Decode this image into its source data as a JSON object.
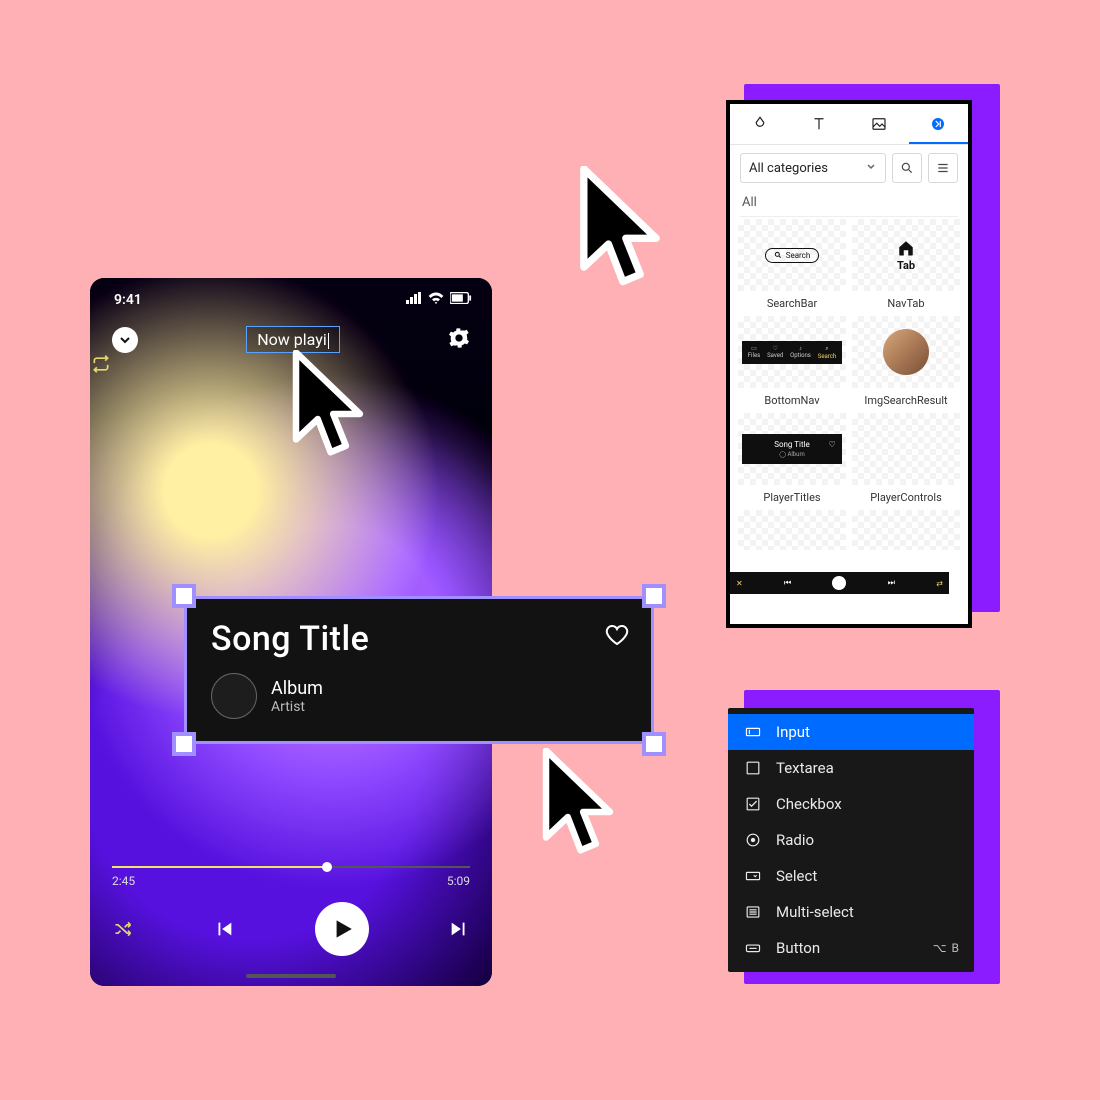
{
  "phone": {
    "status": {
      "time": "9:41"
    },
    "now_playing_input": "Now playi",
    "progress": {
      "elapsed": "2:45",
      "total": "5:09",
      "percent": 60
    },
    "bottom_nav_preview": [
      "Files",
      "Saved",
      "Options",
      "Search"
    ]
  },
  "card": {
    "song_title": "Song Title",
    "album": "Album",
    "artist": "Artist"
  },
  "components_panel": {
    "dropdown": "All categories",
    "heading": "All",
    "items": [
      {
        "label": "SearchBar",
        "kind": "searchbar",
        "text": "Search"
      },
      {
        "label": "NavTab",
        "kind": "navtab",
        "text": "Tab"
      },
      {
        "label": "BottomNav",
        "kind": "bottomnav"
      },
      {
        "label": "ImgSearchResult",
        "kind": "img"
      },
      {
        "label": "PlayerTitles",
        "kind": "titles",
        "title": "Song Title",
        "sub": "Album"
      },
      {
        "label": "PlayerControls",
        "kind": "controls"
      }
    ]
  },
  "menu": {
    "items": [
      {
        "label": "Input",
        "icon": "input",
        "selected": true
      },
      {
        "label": "Textarea",
        "icon": "textarea"
      },
      {
        "label": "Checkbox",
        "icon": "checkbox"
      },
      {
        "label": "Radio",
        "icon": "radio"
      },
      {
        "label": "Select",
        "icon": "select"
      },
      {
        "label": "Multi-select",
        "icon": "multiselect"
      },
      {
        "label": "Button",
        "icon": "button",
        "shortcut": "⌥ B"
      }
    ]
  }
}
